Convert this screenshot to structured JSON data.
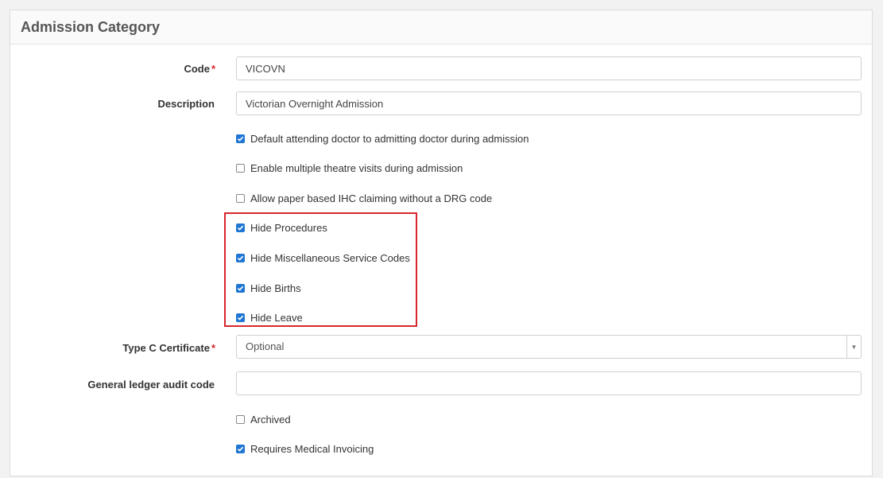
{
  "panel": {
    "title": "Admission Category"
  },
  "form": {
    "code": {
      "label": "Code",
      "required_mark": "*",
      "value": "VICOVN"
    },
    "description": {
      "label": "Description",
      "value": "Victorian Overnight Admission"
    },
    "checkboxes_top": [
      {
        "label": "Default attending doctor to admitting doctor during admission",
        "checked": true
      },
      {
        "label": "Enable multiple theatre visits during admission",
        "checked": false
      },
      {
        "label": "Allow paper based IHC claiming without a DRG code",
        "checked": false
      }
    ],
    "checkboxes_highlighted": [
      {
        "label": "Hide Procedures",
        "checked": true
      },
      {
        "label": "Hide Miscellaneous Service Codes",
        "checked": true
      },
      {
        "label": "Hide Births",
        "checked": true
      },
      {
        "label": "Hide Leave",
        "checked": true
      }
    ],
    "type_c": {
      "label": "Type C Certificate",
      "required_mark": "*",
      "value": "Optional",
      "arrow": "▼"
    },
    "gl_audit": {
      "label": "General ledger audit code",
      "value": ""
    },
    "checkboxes_bottom": [
      {
        "label": "Archived",
        "checked": false
      },
      {
        "label": "Requires Medical Invoicing",
        "checked": true
      }
    ]
  },
  "colors": {
    "accent": "#1f76d2",
    "highlight": "#d7262c",
    "required": "#d9232e"
  }
}
